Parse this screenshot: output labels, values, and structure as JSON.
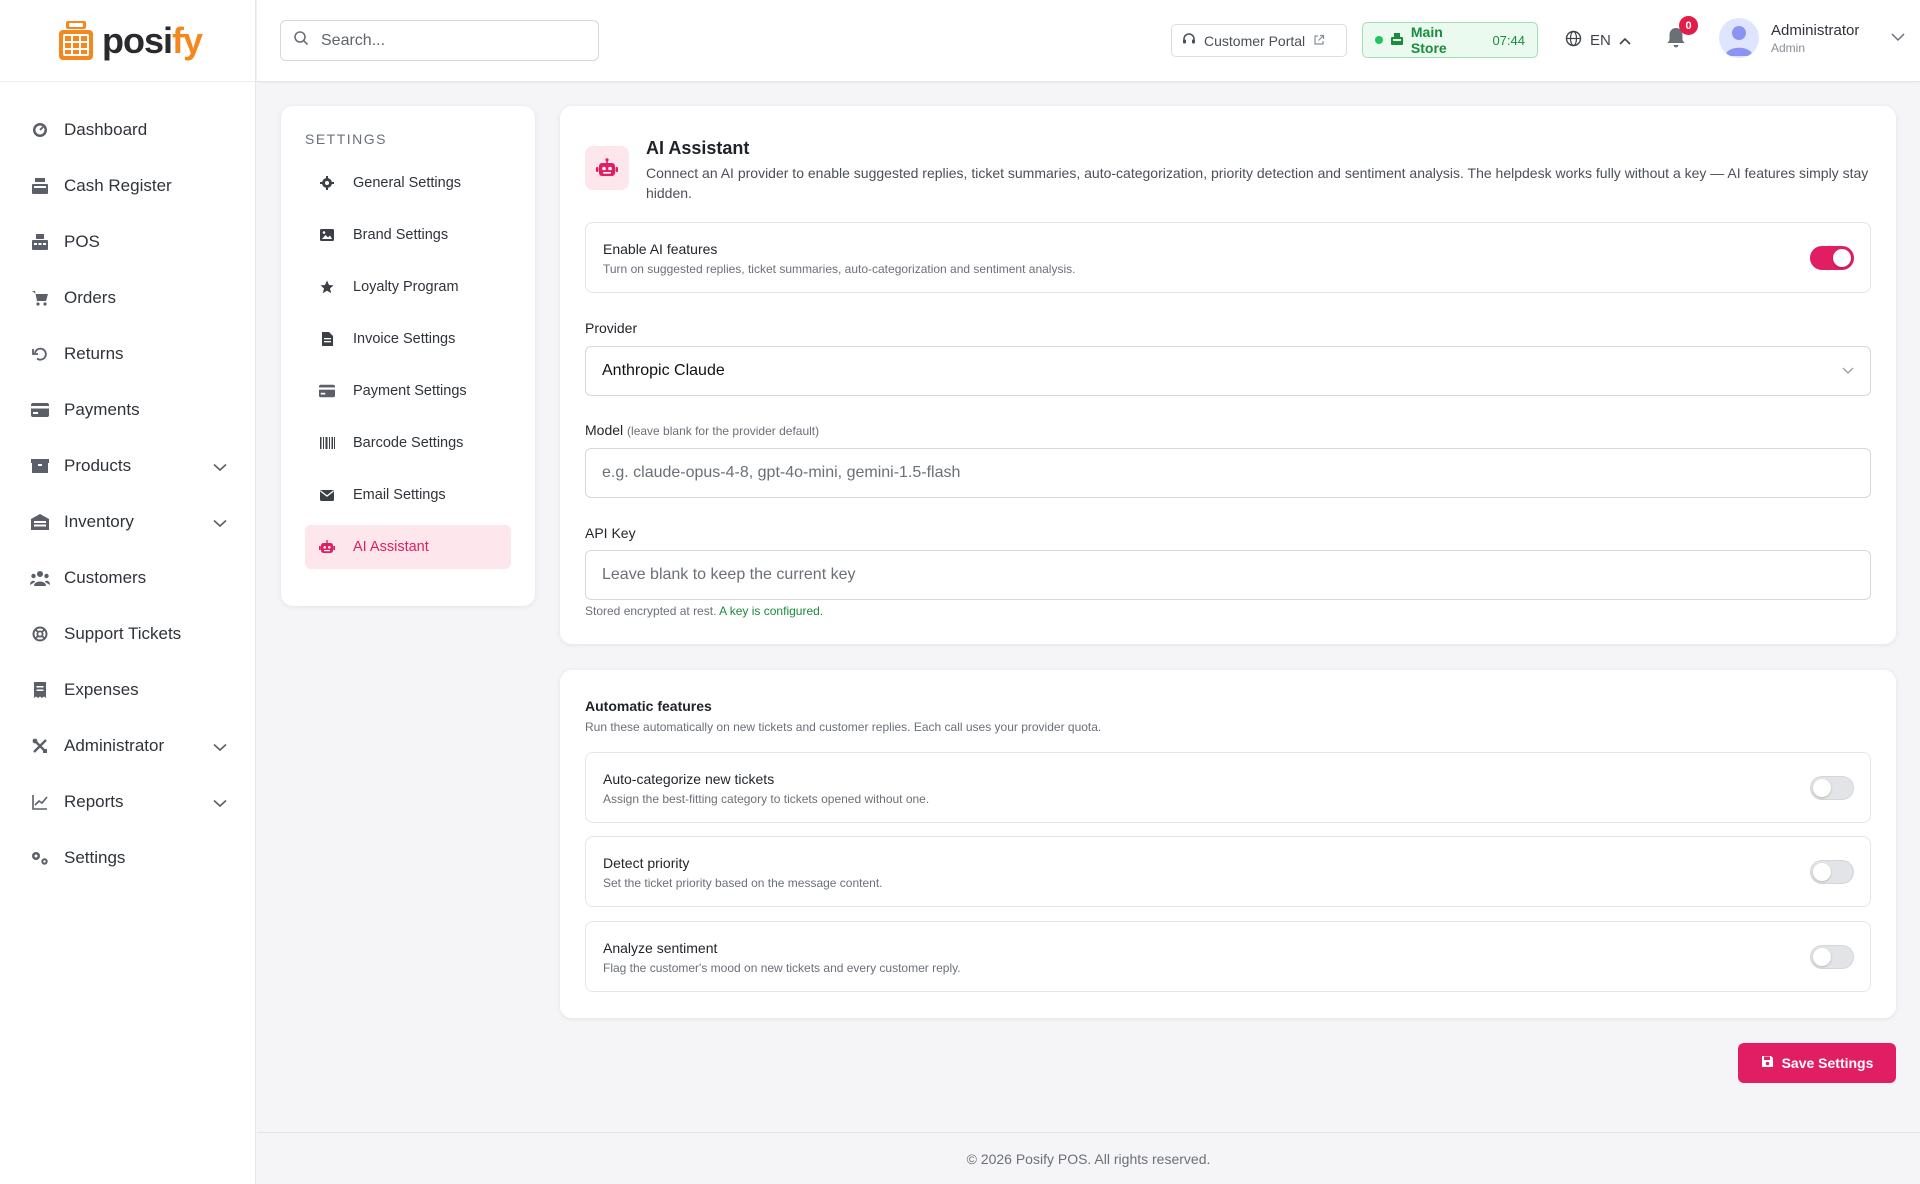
{
  "app": {
    "logo_text_main": "posi",
    "logo_text_accent": "fy",
    "brand_color": "#e11d63",
    "logo_color": "#f5871f"
  },
  "sidebar": {
    "items": [
      {
        "label": "Dashboard",
        "icon": "dashboard-icon"
      },
      {
        "label": "Cash Register",
        "icon": "cash-register-icon"
      },
      {
        "label": "POS",
        "icon": "pos-icon"
      },
      {
        "label": "Orders",
        "icon": "cart-icon"
      },
      {
        "label": "Returns",
        "icon": "undo-icon"
      },
      {
        "label": "Payments",
        "icon": "credit-card-icon"
      },
      {
        "label": "Products",
        "icon": "box-icon",
        "expandable": true
      },
      {
        "label": "Inventory",
        "icon": "warehouse-icon",
        "expandable": true
      },
      {
        "label": "Customers",
        "icon": "users-icon"
      },
      {
        "label": "Support Tickets",
        "icon": "lifebuoy-icon"
      },
      {
        "label": "Expenses",
        "icon": "receipt-icon"
      },
      {
        "label": "Administrator",
        "icon": "tools-icon",
        "expandable": true
      },
      {
        "label": "Reports",
        "icon": "chart-line-icon",
        "expandable": true
      },
      {
        "label": "Settings",
        "icon": "cogs-icon"
      }
    ]
  },
  "header": {
    "search_placeholder": "Search...",
    "customer_portal": "Customer Portal",
    "store_name": "Main Store",
    "store_time": "07:44",
    "language": "EN",
    "notification_count": "0",
    "user_name": "Administrator",
    "user_role": "Admin"
  },
  "settings_menu": {
    "heading": "SETTINGS",
    "items": [
      {
        "label": "General Settings",
        "icon": "gear-icon"
      },
      {
        "label": "Brand Settings",
        "icon": "image-icon"
      },
      {
        "label": "Loyalty Program",
        "icon": "star-icon"
      },
      {
        "label": "Invoice Settings",
        "icon": "file-icon"
      },
      {
        "label": "Payment Settings",
        "icon": "credit-card-icon"
      },
      {
        "label": "Barcode Settings",
        "icon": "barcode-icon"
      },
      {
        "label": "Email Settings",
        "icon": "envelope-icon"
      },
      {
        "label": "AI Assistant",
        "icon": "robot-icon",
        "active": true
      }
    ]
  },
  "ai": {
    "title": "AI Assistant",
    "description": "Connect an AI provider to enable suggested replies, ticket summaries, auto-categorization, priority detection and sentiment analysis. The helpdesk works fully without a key — AI features simply stay hidden.",
    "enable": {
      "title": "Enable AI features",
      "subtitle": "Turn on suggested replies, ticket summaries, auto-categorization and sentiment analysis.",
      "on": true
    },
    "provider_label": "Provider",
    "provider_value": "Anthropic Claude",
    "model_label": "Model",
    "model_hint": "(leave blank for the provider default)",
    "model_placeholder": "e.g. claude-opus-4-8, gpt-4o-mini, gemini-1.5-flash",
    "api_key_label": "API Key",
    "api_key_placeholder": "Leave blank to keep the current key",
    "stored_note": "Stored encrypted at rest.",
    "stored_status": "A key is configured."
  },
  "automatic": {
    "title": "Automatic features",
    "subtitle": "Run these automatically on new tickets and customer replies. Each call uses your provider quota.",
    "items": [
      {
        "title": "Auto-categorize new tickets",
        "subtitle": "Assign the best-fitting category to tickets opened without one.",
        "on": false
      },
      {
        "title": "Detect priority",
        "subtitle": "Set the ticket priority based on the message content.",
        "on": false
      },
      {
        "title": "Analyze sentiment",
        "subtitle": "Flag the customer's mood on new tickets and every customer reply.",
        "on": false
      }
    ]
  },
  "save_label": "Save Settings",
  "footer": "© 2026 Posify POS. All rights reserved."
}
